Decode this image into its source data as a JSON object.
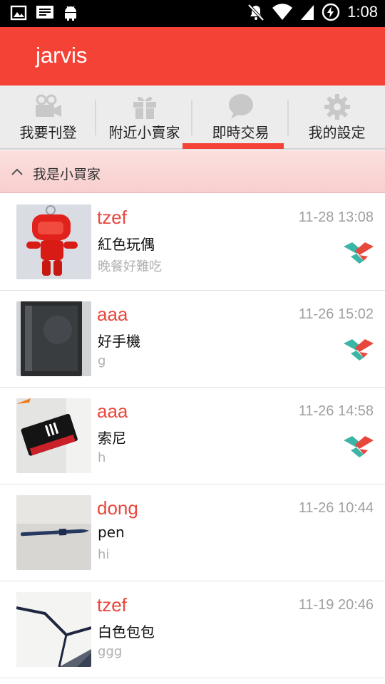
{
  "status_bar": {
    "time": "1:08"
  },
  "app": {
    "title": "jarvis"
  },
  "tabs": [
    {
      "label": "我要刊登",
      "icon": "video-camera-icon",
      "active": false
    },
    {
      "label": "附近小賣家",
      "icon": "gift-icon",
      "active": false
    },
    {
      "label": "即時交易",
      "icon": "chat-bubble-icon",
      "active": true
    },
    {
      "label": "我的設定",
      "icon": "gear-icon",
      "active": false
    }
  ],
  "section": {
    "label": "我是小買家",
    "icon": "chevron-up-icon"
  },
  "items": [
    {
      "user": "tzef",
      "title": "紅色玩偶",
      "message": "晚餐好難吃",
      "time": "11-28 13:08",
      "deal_icon": true
    },
    {
      "user": "aaa",
      "title": "好手機",
      "message": "g",
      "time": "11-26 15:02",
      "deal_icon": true
    },
    {
      "user": "aaa",
      "title": "索尼",
      "message": "h",
      "time": "11-26 14:58",
      "deal_icon": true
    },
    {
      "user": "dong",
      "title": "pen",
      "message": "hi",
      "time": "11-26 10:44",
      "deal_icon": false
    },
    {
      "user": "tzef",
      "title": "白色包包",
      "message": "ggg",
      "time": "11-19 20:46",
      "deal_icon": false
    }
  ],
  "colors": {
    "accent": "#f44236",
    "username": "#e8473c",
    "deal_teal": "#3bb5a6",
    "deal_red": "#e8473c"
  }
}
